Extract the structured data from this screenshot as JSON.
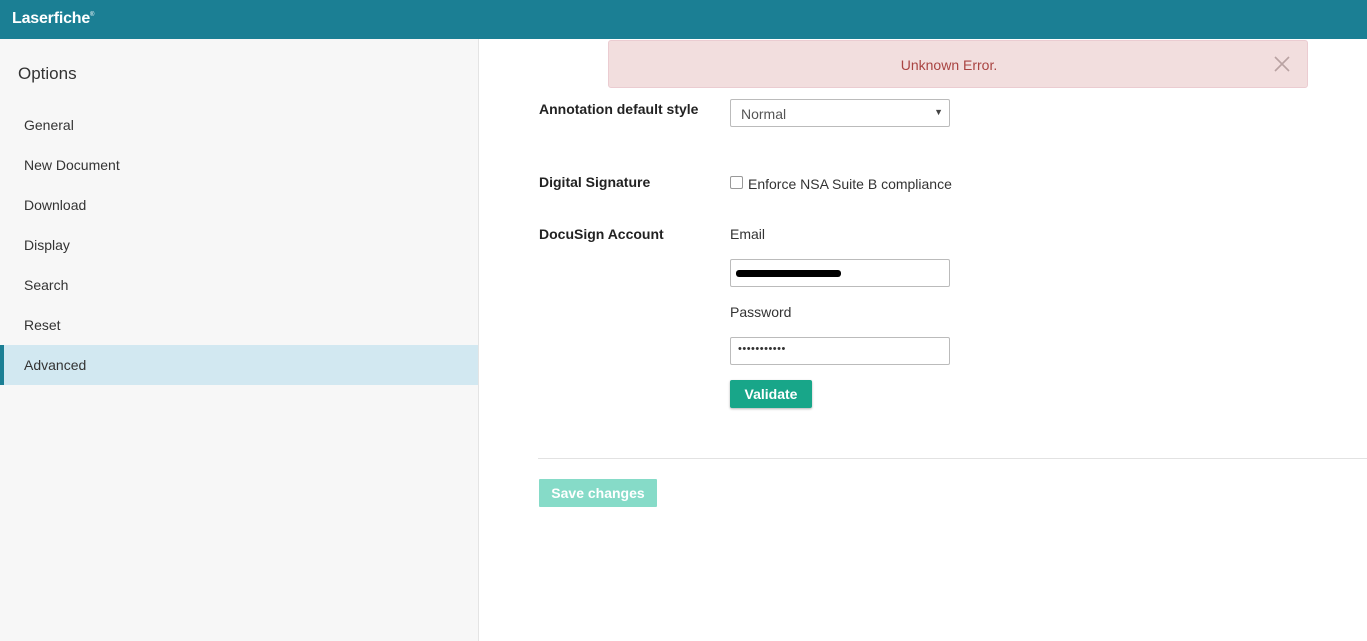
{
  "app": {
    "logo": "Laserfiche",
    "logo_mark": "®"
  },
  "sidebar": {
    "title": "Options",
    "items": [
      {
        "label": "General",
        "active": false
      },
      {
        "label": "New Document",
        "active": false
      },
      {
        "label": "Download",
        "active": false
      },
      {
        "label": "Display",
        "active": false
      },
      {
        "label": "Search",
        "active": false
      },
      {
        "label": "Reset",
        "active": false
      },
      {
        "label": "Advanced",
        "active": true
      }
    ]
  },
  "alert": {
    "message": "Unknown Error.",
    "close_icon": "close-icon"
  },
  "annotation": {
    "label": "Annotation default style",
    "selected": "Normal",
    "caret": "▼"
  },
  "digital_signature": {
    "label": "Digital Signature",
    "checkbox_label": "Enforce NSA Suite B compliance",
    "checked": false
  },
  "docusign": {
    "label": "DocuSign Account",
    "email_label": "Email",
    "password_label": "Password",
    "password_value": "•••••••••••",
    "validate_label": "Validate"
  },
  "save_label": "Save changes",
  "colors": {
    "header": "#1b7f94",
    "active_item": "#d2e8f1",
    "alert_bg": "#f2dede",
    "alert_text": "#a94442",
    "validate_button": "#18a689",
    "save_button_disabled": "#86dbc8"
  }
}
